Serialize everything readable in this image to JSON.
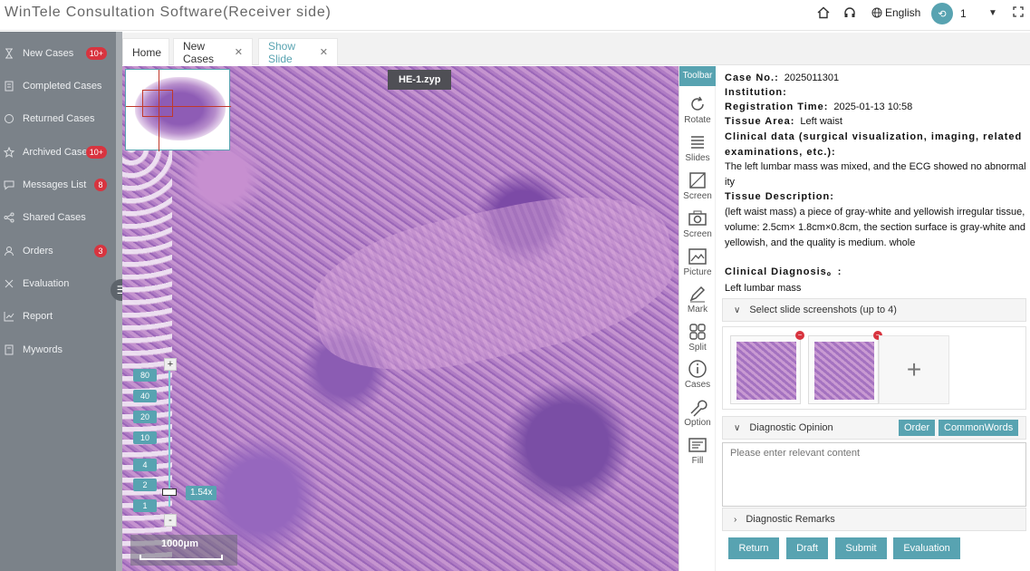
{
  "app": {
    "title": "WinTele Consultation Software(Receiver side)"
  },
  "header": {
    "home_icon": "home-icon",
    "headset_icon": "headset-icon",
    "language": "English",
    "avatar_letter": "⟲",
    "user_name": "1"
  },
  "sidebar": {
    "items": [
      {
        "label": "New Cases",
        "icon": "hourglass-icon",
        "badge": "10+"
      },
      {
        "label": "Completed Cases",
        "icon": "document-icon",
        "badge": ""
      },
      {
        "label": "Returned Cases",
        "icon": "return-icon",
        "badge": ""
      },
      {
        "label": "Archived Cases",
        "icon": "star-icon",
        "badge": "10+"
      },
      {
        "label": "Messages List",
        "icon": "chat-icon",
        "badge": "8"
      },
      {
        "label": "Shared Cases",
        "icon": "share-icon",
        "badge": ""
      },
      {
        "label": "Orders",
        "icon": "person-icon",
        "badge": "3"
      },
      {
        "label": "Evaluation",
        "icon": "evaluation-icon",
        "badge": ""
      },
      {
        "label": "Report",
        "icon": "chart-icon",
        "badge": ""
      },
      {
        "label": "Mywords",
        "icon": "words-icon",
        "badge": ""
      }
    ]
  },
  "tabs": [
    {
      "label": "Home",
      "closable": false,
      "active": false
    },
    {
      "label": "New Cases",
      "closable": true,
      "active": false
    },
    {
      "label": "Show Slide",
      "closable": true,
      "active": true
    }
  ],
  "viewer": {
    "slide_name": "HE-1.zyp",
    "zoom_levels": [
      "80",
      "40",
      "20",
      "10",
      "4",
      "2",
      "1"
    ],
    "zoom_in": "+",
    "zoom_out": "-",
    "zoom_value": "1.54x",
    "scale_label": "1000μm"
  },
  "toolbar": {
    "title": "Toolbar",
    "tools": [
      "Rotate",
      "Slides",
      "Screen",
      "Screen",
      "Picture",
      "Mark",
      "Split",
      "Cases",
      "Option",
      "Fill"
    ]
  },
  "case": {
    "case_no_label": "Case No.:",
    "case_no": "2025011301",
    "institution_label": "Institution:",
    "institution": "",
    "registration_label": "Registration Time:",
    "registration_time": "2025-01-13 10:58",
    "tissue_area_label": "Tissue Area:",
    "tissue_area": "Left waist",
    "clinical_data_label": "Clinical data (surgical visualization, imaging, related examinations, etc.):",
    "clinical_data": "The left lumbar mass was mixed, and the ECG showed no abnormality",
    "tissue_desc_label": "Tissue Description:",
    "tissue_desc": "(left waist mass) a piece of gray-white and yellowish irregular tissue, volume: 2.5cm× 1.8cm×0.8cm, the section surface is gray-white and yellowish, and the quality is medium. whole",
    "diagnosis_label": "Clinical Diagnosis。:",
    "diagnosis": "Left lumbar mass"
  },
  "screenshots": {
    "title": "Select slide screenshots (up to 4)",
    "delete_symbol": "−",
    "add_symbol": "+"
  },
  "opinion": {
    "title": "Diagnostic Opinion",
    "order_btn": "Order",
    "common_words_btn": "CommonWords",
    "placeholder": "Please enter relevant content"
  },
  "remarks": {
    "title": "Diagnostic Remarks"
  },
  "actions": {
    "return": "Return",
    "draft": "Draft",
    "submit": "Submit",
    "evaluation": "Evaluation"
  },
  "colors": {
    "accent": "#58a3b1",
    "sidebar": "#7b8289",
    "badge": "#d8343f"
  }
}
